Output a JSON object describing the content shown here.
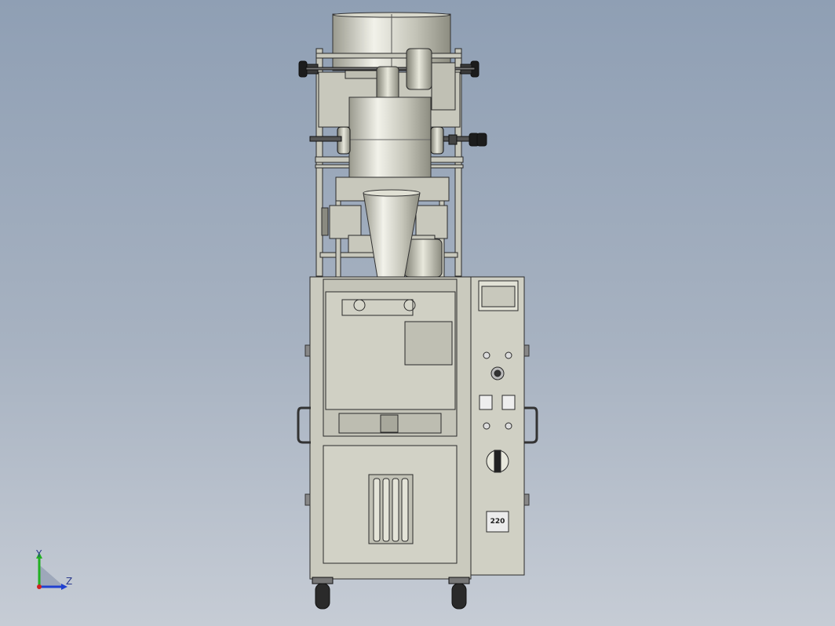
{
  "viewport": {
    "background_top": "#8f9fb4",
    "background_bottom": "#c6ccd5",
    "part_color": "#c8c8bc",
    "line_color": "#2a2a2a"
  },
  "control_panel": {
    "voltage_label": "220"
  },
  "triad": {
    "y_label": "Y",
    "z_label": "Z",
    "y_color": "#22b022",
    "z_color": "#2040d0",
    "origin_color": "#d02020"
  }
}
